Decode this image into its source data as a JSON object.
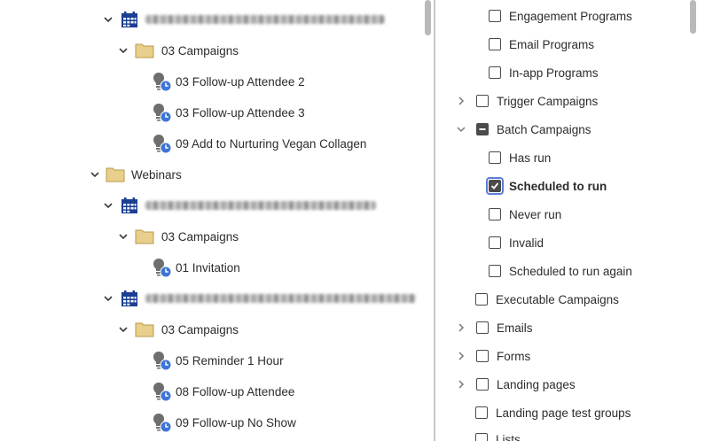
{
  "tree": {
    "items": [
      {
        "id": "event1",
        "label": "",
        "type": "event"
      },
      {
        "id": "event1-campaigns",
        "label": "03 Campaigns",
        "type": "folder"
      },
      {
        "id": "event1-c1",
        "label": "03 Follow-up Attendee 2",
        "type": "campaign"
      },
      {
        "id": "event1-c2",
        "label": "03 Follow-up Attendee 3",
        "type": "campaign"
      },
      {
        "id": "event1-c3",
        "label": "09 Add to Nurturing Vegan Collagen",
        "type": "campaign"
      },
      {
        "id": "webinars",
        "label": "Webinars",
        "type": "folder"
      },
      {
        "id": "event2",
        "label": "",
        "type": "event"
      },
      {
        "id": "event2-campaigns",
        "label": "03 Campaigns",
        "type": "folder"
      },
      {
        "id": "event2-c1",
        "label": "01 Invitation",
        "type": "campaign"
      },
      {
        "id": "event3",
        "label": "",
        "type": "event"
      },
      {
        "id": "event3-campaigns",
        "label": "03 Campaigns",
        "type": "folder"
      },
      {
        "id": "event3-c1",
        "label": "05 Reminder 1 Hour",
        "type": "campaign"
      },
      {
        "id": "event3-c2",
        "label": "08 Follow-up Attendee",
        "type": "campaign"
      },
      {
        "id": "event3-c3",
        "label": "09 Follow-up No Show",
        "type": "campaign"
      }
    ]
  },
  "filters": {
    "items": [
      {
        "label": "Engagement Programs",
        "state": "unchecked"
      },
      {
        "label": "Email Programs",
        "state": "unchecked"
      },
      {
        "label": "In-app Programs",
        "state": "unchecked"
      },
      {
        "label": "Trigger Campaigns",
        "state": "unchecked",
        "expander": "collapsed"
      },
      {
        "label": "Batch Campaigns",
        "state": "mixed",
        "expander": "expanded"
      },
      {
        "label": "Has run",
        "state": "unchecked"
      },
      {
        "label": "Scheduled to run",
        "state": "checked"
      },
      {
        "label": "Never run",
        "state": "unchecked"
      },
      {
        "label": "Invalid",
        "state": "unchecked"
      },
      {
        "label": "Scheduled to run again",
        "state": "unchecked"
      },
      {
        "label": "Executable Campaigns",
        "state": "unchecked"
      },
      {
        "label": "Emails",
        "state": "unchecked",
        "expander": "collapsed"
      },
      {
        "label": "Forms",
        "state": "unchecked",
        "expander": "collapsed"
      },
      {
        "label": "Landing pages",
        "state": "unchecked",
        "expander": "collapsed"
      },
      {
        "label": "Landing page test groups",
        "state": "unchecked"
      },
      {
        "label": "Lists",
        "state": "unchecked"
      }
    ]
  },
  "colors": {
    "folder": "#e8cf8c",
    "calendar": "#1c3f94",
    "clock": "#3d74d9",
    "bulb": "#6e6e6e",
    "focus": "#5b7fd6"
  }
}
